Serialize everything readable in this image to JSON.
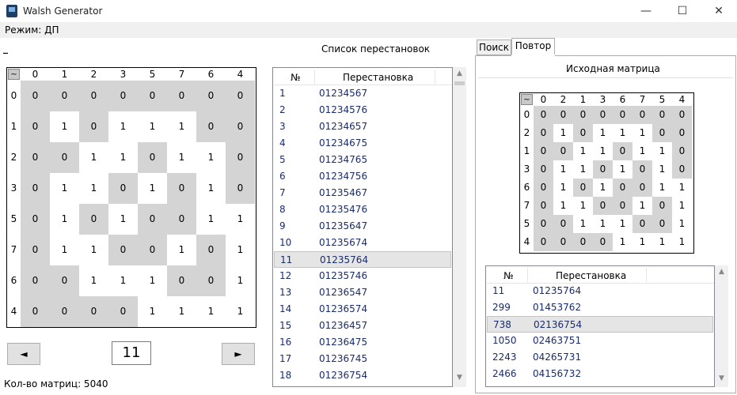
{
  "window": {
    "title": "Walsh Generator",
    "minimize_glyph": "—",
    "maximize_glyph": "☐",
    "close_glyph": "✕"
  },
  "menu": {
    "mode_label": "Режим: ДП"
  },
  "left": {
    "indicator": "_",
    "list_title": "Список перестановок",
    "corner": "~",
    "header": [
      "0",
      "1",
      "2",
      "3",
      "5",
      "7",
      "6",
      "4"
    ],
    "rows": [
      "0",
      "1",
      "2",
      "3",
      "5",
      "7",
      "6",
      "4"
    ],
    "matrix": [
      [
        0,
        0,
        0,
        0,
        0,
        0,
        0,
        0
      ],
      [
        0,
        1,
        0,
        1,
        1,
        1,
        0,
        0
      ],
      [
        0,
        0,
        1,
        1,
        0,
        1,
        1,
        0
      ],
      [
        0,
        1,
        1,
        0,
        1,
        0,
        1,
        0
      ],
      [
        0,
        1,
        0,
        1,
        0,
        0,
        1,
        1
      ],
      [
        0,
        1,
        1,
        0,
        0,
        1,
        0,
        1
      ],
      [
        0,
        0,
        1,
        1,
        1,
        0,
        0,
        1
      ],
      [
        0,
        0,
        0,
        0,
        1,
        1,
        1,
        1
      ]
    ],
    "white_cells": [
      [],
      [
        1,
        3,
        4,
        5
      ],
      [
        2,
        3,
        5,
        6
      ],
      [
        1,
        2,
        4,
        6
      ],
      [
        1,
        3,
        6,
        7
      ],
      [
        1,
        2,
        5,
        7
      ],
      [
        2,
        3,
        4,
        7
      ],
      [
        4,
        5,
        6,
        7
      ]
    ],
    "prev_label": "◄",
    "next_label": "►",
    "current_number": "11",
    "count_label": "Кол-во матриц: 5040"
  },
  "perm_list": {
    "col_num": "№",
    "col_perm": "Перестановка",
    "selected_index": 10,
    "items": [
      {
        "n": "1",
        "p": "01234567"
      },
      {
        "n": "2",
        "p": "01234576"
      },
      {
        "n": "3",
        "p": "01234657"
      },
      {
        "n": "4",
        "p": "01234675"
      },
      {
        "n": "5",
        "p": "01234765"
      },
      {
        "n": "6",
        "p": "01234756"
      },
      {
        "n": "7",
        "p": "01235467"
      },
      {
        "n": "8",
        "p": "01235476"
      },
      {
        "n": "9",
        "p": "01235647"
      },
      {
        "n": "10",
        "p": "01235674"
      },
      {
        "n": "11",
        "p": "01235764"
      },
      {
        "n": "12",
        "p": "01235746"
      },
      {
        "n": "13",
        "p": "01236547"
      },
      {
        "n": "14",
        "p": "01236574"
      },
      {
        "n": "15",
        "p": "01236457"
      },
      {
        "n": "16",
        "p": "01236475"
      },
      {
        "n": "17",
        "p": "01236745"
      },
      {
        "n": "18",
        "p": "01236754"
      }
    ]
  },
  "tabs": [
    {
      "label": "Поиск",
      "active": false
    },
    {
      "label": "Повтор",
      "active": true
    }
  ],
  "right": {
    "matrix_title": "Исходная матрица",
    "corner": "~",
    "header": [
      "0",
      "2",
      "1",
      "3",
      "6",
      "7",
      "5",
      "4"
    ],
    "rows": [
      "0",
      "2",
      "1",
      "3",
      "6",
      "7",
      "5",
      "4"
    ],
    "matrix": [
      [
        0,
        0,
        0,
        0,
        0,
        0,
        0,
        0
      ],
      [
        0,
        1,
        0,
        1,
        1,
        1,
        0,
        0
      ],
      [
        0,
        0,
        1,
        1,
        0,
        1,
        1,
        0
      ],
      [
        0,
        1,
        1,
        0,
        1,
        0,
        1,
        0
      ],
      [
        0,
        1,
        0,
        1,
        0,
        0,
        1,
        1
      ],
      [
        0,
        1,
        1,
        0,
        0,
        1,
        0,
        1
      ],
      [
        0,
        0,
        1,
        1,
        1,
        0,
        0,
        1
      ],
      [
        0,
        0,
        0,
        0,
        1,
        1,
        1,
        1
      ]
    ],
    "white_cells": [
      [],
      [
        1,
        3,
        4,
        5
      ],
      [
        2,
        3,
        5,
        6
      ],
      [
        1,
        2,
        4,
        6
      ],
      [
        1,
        3,
        6,
        7
      ],
      [
        1,
        2,
        5,
        7
      ],
      [
        2,
        3,
        4,
        7
      ],
      [
        4,
        5,
        6,
        7
      ]
    ],
    "repeat_list": {
      "col_num": "№",
      "col_perm": "Перестановка",
      "selected_index": 2,
      "items": [
        {
          "n": "11",
          "p": "01235764"
        },
        {
          "n": "299",
          "p": "01453762"
        },
        {
          "n": "738",
          "p": "02136754"
        },
        {
          "n": "1050",
          "p": "02463751"
        },
        {
          "n": "2243",
          "p": "04265731"
        },
        {
          "n": "2466",
          "p": "04156732"
        }
      ]
    }
  },
  "colors": {
    "gray": "#d4d4d4",
    "text_blue": "#1a2c6b",
    "selected_row": "#e5e5e5"
  }
}
